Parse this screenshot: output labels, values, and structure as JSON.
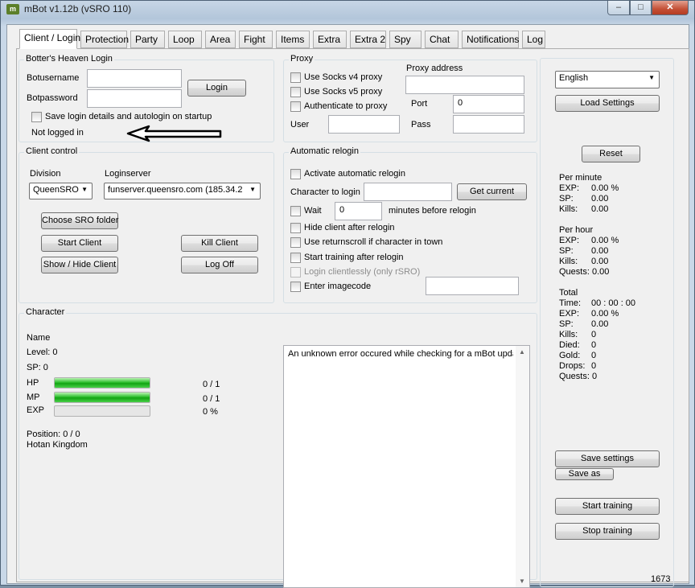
{
  "window": {
    "title": "mBot v1.12b (vSRO 110)",
    "icon_name": "mbot-app-icon",
    "icon_text": "m",
    "minimize_glyph": "–",
    "maximize_glyph": "□",
    "close_glyph": "✕"
  },
  "tabs": [
    "Client / Login",
    "Protection",
    "Party",
    "Loop",
    "Area",
    "Fight",
    "Items",
    "Extra",
    "Extra 2",
    "Spy",
    "Chat",
    "Notifications",
    "Log"
  ],
  "active_tab": "Client / Login",
  "login": {
    "group_title": "Botter's Heaven Login",
    "username_label": "Botusername",
    "username_value": "",
    "password_label": "Botpassword",
    "password_value": "",
    "login_button": "Login",
    "save_login_label": "Save login details and autologin on startup",
    "save_login_checked": false,
    "status_text": "Not logged in"
  },
  "proxy": {
    "group_title": "Proxy",
    "socks4_label": "Use Socks v4 proxy",
    "socks5_label": "Use Socks v5 proxy",
    "auth_label": "Authenticate to proxy",
    "address_label": "Proxy address",
    "address_value": "",
    "port_label": "Port",
    "port_value": "0",
    "user_label": "User",
    "user_value": "",
    "pass_label": "Pass",
    "pass_value": ""
  },
  "client_control": {
    "group_title": "Client control",
    "division_label": "Division",
    "division_value": "QueenSRO",
    "loginserver_label": "Loginserver",
    "loginserver_value": "funserver.queensro.com (185.34.2",
    "choose_folder_button": "Choose SRO folder",
    "start_client_button": "Start Client",
    "kill_client_button": "Kill Client",
    "show_hide_button": "Show / Hide Client",
    "log_off_button": "Log Off"
  },
  "relogin": {
    "group_title": "Automatic relogin",
    "activate_label": "Activate automatic relogin",
    "character_label": "Character to login",
    "character_value": "",
    "get_current_button": "Get current",
    "wait_label": "Wait",
    "wait_value": "0",
    "wait_suffix": "minutes before relogin",
    "hide_client_label": "Hide client after relogin",
    "returnscroll_label": "Use returnscroll if character in town",
    "start_training_label": "Start training after relogin",
    "clientless_label": "Login clientlessly (only rSRO)",
    "imagecode_label": "Enter imagecode",
    "imagecode_value": ""
  },
  "character": {
    "group_title": "Character",
    "name_label": "Name",
    "level_text": "Level: 0",
    "sp_text": "SP: 0",
    "hp_label": "HP",
    "hp_value": "0 / 1",
    "hp_fill": 1.0,
    "mp_label": "MP",
    "mp_value": "0 / 1",
    "mp_fill": 1.0,
    "exp_label": "EXP",
    "exp_value": "0 %",
    "exp_fill": 0.0,
    "position_text": "Position: 0 / 0",
    "location_text": "Hotan Kingdom"
  },
  "log": {
    "text": "An unknown error occured while checking for a mBot upda"
  },
  "right": {
    "language_value": "English",
    "load_settings_button": "Load Settings",
    "reset_button": "Reset",
    "per_minute_title": "Per minute",
    "per_minute": [
      {
        "label": "EXP:",
        "value": "0.00 %"
      },
      {
        "label": "SP:",
        "value": "0.00"
      },
      {
        "label": "Kills:",
        "value": "0.00"
      }
    ],
    "per_hour_title": "Per hour",
    "per_hour": [
      {
        "label": "EXP:",
        "value": "0.00 %"
      },
      {
        "label": "SP:",
        "value": "0.00"
      },
      {
        "label": "Kills:",
        "value": "0.00"
      },
      {
        "label": "Quests:",
        "value": "0.00"
      }
    ],
    "total_title": "Total",
    "total": [
      {
        "label": "Time:",
        "value": "00 : 00 : 00"
      },
      {
        "label": "EXP:",
        "value": "0.00 %"
      },
      {
        "label": "SP:",
        "value": "0.00"
      },
      {
        "label": "Kills:",
        "value": "0"
      },
      {
        "label": "Died:",
        "value": "0"
      },
      {
        "label": "Gold:",
        "value": "0"
      },
      {
        "label": "Drops:",
        "value": "0"
      },
      {
        "label": "Quests:",
        "value": "0"
      }
    ],
    "save_settings_button": "Save settings",
    "save_as_button": "Save as",
    "start_training_button": "Start training",
    "stop_training_button": "Stop training"
  },
  "status_bar": {
    "counter": "1673"
  }
}
